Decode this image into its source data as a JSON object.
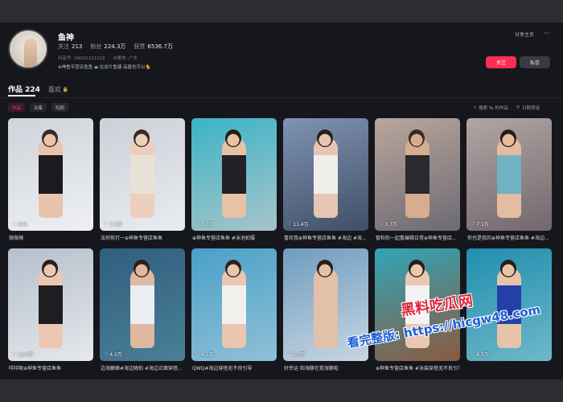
{
  "profile": {
    "name": "鱼神",
    "stats": [
      {
        "label": "关注",
        "value": "213"
      },
      {
        "label": "粉丝",
        "value": "224.3万"
      },
      {
        "label": "获赞",
        "value": "6536.7万"
      }
    ],
    "douyin_id": "抖音号: 09002231318",
    "ip_location": "IP属地: 广东",
    "bio": "⊕神鱼专营店鱼鱼 🐟在这片鱼塘 品屋也可以🐈",
    "share_label": "分享主页",
    "more_label": "···",
    "follow_label": "关注",
    "message_label": "私信"
  },
  "tabs": {
    "works": "作品 224",
    "likes": "喜欢",
    "lock_icon": "🔒"
  },
  "chips": [
    "作品",
    "合集",
    "短剧"
  ],
  "toolbar": {
    "search_label": "搜索 Ta 的作品",
    "sort_label": "日期筛选"
  },
  "videos": [
    {
      "likes": "644",
      "caption": "微微辣",
      "bg": [
        "#cfd3da",
        "#eef0f3"
      ],
      "skin": "#e8c4ad",
      "outfit": "#1a1a1f",
      "hair": "#3a2a22"
    },
    {
      "likes": "3.4万",
      "caption": "法师剪打一⊕神鱼专营店鱼鱼",
      "bg": [
        "#cbd0d8",
        "#e9ecef"
      ],
      "skin": "#ecd0bd",
      "outfit": "#e8e2d6",
      "hair": "#3b2b24"
    },
    {
      "likes": "3.3万",
      "caption": "⊕神鱼专营店鱼鱼 #泳池拍摄",
      "bg": [
        "#3bb3c8",
        "#a8c4c9"
      ],
      "skin": "#e7c2a6",
      "outfit": "#222127",
      "hair": "#2a1c16"
    },
    {
      "likes": "11.4万",
      "caption": "喜欢我⊕神鱼专营店鱼鱼 #海边 #海...",
      "bg": [
        "#7f93b3",
        "#3f4f66"
      ],
      "skin": "#e6c6b2",
      "outfit": "#f1efeb",
      "hair": "#2d2019"
    },
    {
      "likes": "3.7万",
      "caption": "管和你一起看编辑日常⊕神鱼专营店...",
      "bg": [
        "#b9a69b",
        "#6d6a74"
      ],
      "skin": "#d7ad90",
      "outfit": "#2a2a2e",
      "hair": "#3a2a20"
    },
    {
      "likes": "7.1万",
      "caption": "你也是我的⊕神鱼专营店鱼鱼 #海边...",
      "bg": [
        "#b1a5a4",
        "#72686c"
      ],
      "skin": "#e3bca2",
      "outfit": "#6fb2c2",
      "hair": "#2a1c16"
    },
    {
      "likes": "14.9万",
      "caption": "咩咩呢⊕神鱼专营店鱼鱼",
      "bg": [
        "#b5bfcc",
        "#e6e8ec"
      ],
      "skin": "#ecc8b2",
      "outfit": "#1d1d22",
      "hair": "#2a1e18"
    },
    {
      "likes": "4.0万",
      "caption": "边海巅峰#海边随拍 #海边正面穿搭...",
      "bg": [
        "#2f5f7e",
        "#4a7f97"
      ],
      "skin": "#e0b8a0",
      "outfit": "#e9eef2",
      "hair": "#2b1e17"
    },
    {
      "likes": "4.1万",
      "caption": "QWQ#海边穿搭无不良引导",
      "bg": [
        "#4aa0c8",
        "#8fc0d6"
      ],
      "skin": "#e8c6b0",
      "outfit": "#f2f0ec",
      "hair": "#30221a"
    },
    {
      "likes": "5.0万",
      "caption": "好幸运 和海豚在我海豚啦",
      "bg": [
        "#6f9cc0",
        "#c7d6e1"
      ],
      "skin": "#e3c0a8",
      "outfit": "#e3c0a8",
      "hair": "#2b1f18"
    },
    {
      "likes": "",
      "caption": "⊕神鱼专营店鱼鱼 #泳装穿搭无不良引导",
      "bg": [
        "#2fa6b8",
        "#8b5a3f"
      ],
      "skin": "#e9c7b0",
      "outfit": "#f3f3f3",
      "hair": "#2a1c16"
    },
    {
      "likes": "6.5万",
      "caption": "",
      "bg": [
        "#1f8fae",
        "#6fb7c9"
      ],
      "skin": "#e7c3aa",
      "outfit": "#2340a8",
      "hair": "#2a1d17"
    }
  ],
  "watermark": {
    "line1": "黑料吃瓜网",
    "line2": "看完整版: https://hicgw48.com"
  },
  "icons": {
    "heart": "♡",
    "search": "⌕",
    "sort": "⚲"
  },
  "colors": {
    "accent": "#fe2c55",
    "background": "#16171c"
  }
}
